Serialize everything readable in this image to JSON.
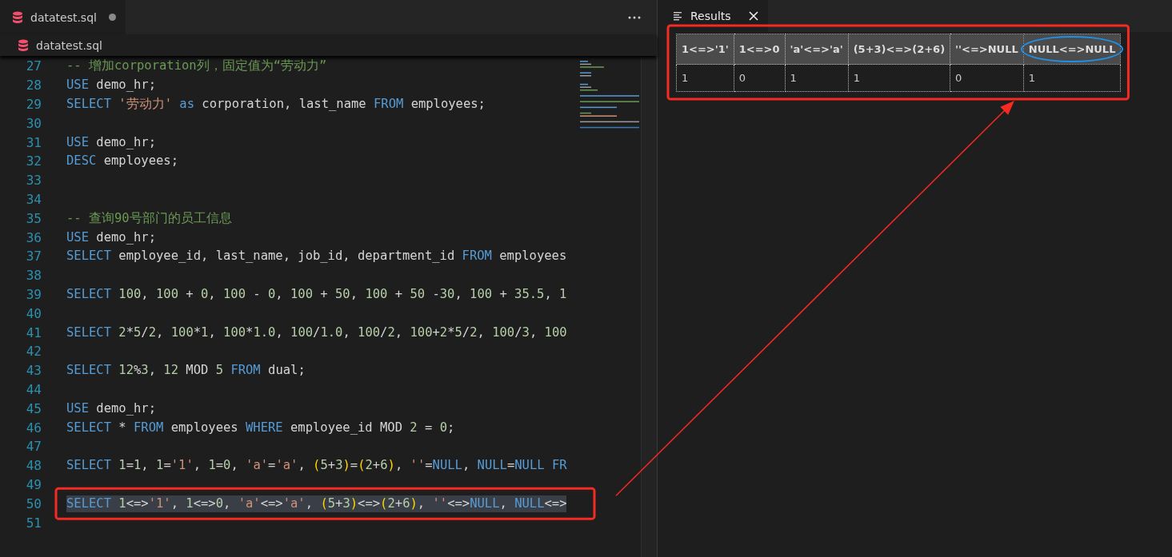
{
  "editor": {
    "tabs": [
      {
        "label": "datatest.sql",
        "modified": true,
        "selected": true
      }
    ],
    "breadcrumb": "datatest.sql",
    "lines": [
      {
        "number": "27",
        "selected": false,
        "boxed": false,
        "tokens": [
          {
            "kind": "comment",
            "text": "-- 增加corporation列，固定值为“劳动力”"
          }
        ]
      },
      {
        "number": "28",
        "selected": false,
        "boxed": false,
        "tokens": [
          {
            "kind": "keyword",
            "text": "USE"
          },
          {
            "kind": "plain",
            "text": " demo_hr;"
          }
        ]
      },
      {
        "number": "29",
        "selected": false,
        "boxed": false,
        "tokens": [
          {
            "kind": "keyword",
            "text": "SELECT"
          },
          {
            "kind": "string",
            "text": " '劳动力'"
          },
          {
            "kind": "keyword",
            "text": " as"
          },
          {
            "kind": "plain",
            "text": " corporation, last_name "
          },
          {
            "kind": "keyword",
            "text": "FROM"
          },
          {
            "kind": "plain",
            "text": " employees;"
          }
        ]
      },
      {
        "number": "30",
        "selected": false,
        "boxed": false
      },
      {
        "number": "31",
        "selected": false,
        "boxed": false,
        "tokens": [
          {
            "kind": "keyword",
            "text": "USE"
          },
          {
            "kind": "plain",
            "text": " demo_hr;"
          }
        ]
      },
      {
        "number": "32",
        "selected": false,
        "boxed": false,
        "tokens": [
          {
            "kind": "keyword",
            "text": "DESC"
          },
          {
            "kind": "plain",
            "text": " employees;"
          }
        ]
      },
      {
        "number": "33",
        "selected": false,
        "boxed": false
      },
      {
        "number": "34",
        "selected": false,
        "boxed": false
      },
      {
        "number": "35",
        "selected": false,
        "boxed": false,
        "tokens": [
          {
            "kind": "comment",
            "text": "-- 查询90号部门的员工信息"
          }
        ]
      },
      {
        "number": "36",
        "selected": false,
        "boxed": false,
        "tokens": [
          {
            "kind": "keyword",
            "text": "USE"
          },
          {
            "kind": "plain",
            "text": " demo_hr;"
          }
        ]
      },
      {
        "number": "37",
        "selected": false,
        "boxed": false,
        "tokens": [
          {
            "kind": "keyword",
            "text": "SELECT"
          },
          {
            "kind": "plain",
            "text": " employee_id, last_name, job_id, department_id "
          },
          {
            "kind": "keyword",
            "text": "FROM"
          },
          {
            "kind": "plain",
            "text": " employees"
          }
        ]
      },
      {
        "number": "38",
        "selected": false,
        "boxed": false
      },
      {
        "number": "39",
        "selected": false,
        "boxed": false,
        "tokens": [
          {
            "kind": "keyword",
            "text": "SELECT"
          },
          {
            "kind": "number",
            "text": " 100"
          },
          {
            "kind": "plain",
            "text": ", "
          },
          {
            "kind": "number",
            "text": "100"
          },
          {
            "kind": "plain",
            "text": " + "
          },
          {
            "kind": "number",
            "text": "0"
          },
          {
            "kind": "plain",
            "text": ", "
          },
          {
            "kind": "number",
            "text": "100"
          },
          {
            "kind": "plain",
            "text": " - "
          },
          {
            "kind": "number",
            "text": "0"
          },
          {
            "kind": "plain",
            "text": ", "
          },
          {
            "kind": "number",
            "text": "100"
          },
          {
            "kind": "plain",
            "text": " + "
          },
          {
            "kind": "number",
            "text": "50"
          },
          {
            "kind": "plain",
            "text": ", "
          },
          {
            "kind": "number",
            "text": "100"
          },
          {
            "kind": "plain",
            "text": " + "
          },
          {
            "kind": "number",
            "text": "50"
          },
          {
            "kind": "plain",
            "text": " -"
          },
          {
            "kind": "number",
            "text": "30"
          },
          {
            "kind": "plain",
            "text": ", "
          },
          {
            "kind": "number",
            "text": "100"
          },
          {
            "kind": "plain",
            "text": " + "
          },
          {
            "kind": "number",
            "text": "35.5"
          },
          {
            "kind": "plain",
            "text": ", "
          },
          {
            "kind": "number",
            "text": "1"
          }
        ]
      },
      {
        "number": "40",
        "selected": false,
        "boxed": false
      },
      {
        "number": "41",
        "selected": false,
        "boxed": false,
        "tokens": [
          {
            "kind": "keyword",
            "text": "SELECT"
          },
          {
            "kind": "number",
            "text": " 2"
          },
          {
            "kind": "plain",
            "text": "*"
          },
          {
            "kind": "number",
            "text": "5"
          },
          {
            "kind": "plain",
            "text": "/"
          },
          {
            "kind": "number",
            "text": "2"
          },
          {
            "kind": "plain",
            "text": ", "
          },
          {
            "kind": "number",
            "text": "100"
          },
          {
            "kind": "plain",
            "text": "*"
          },
          {
            "kind": "number",
            "text": "1"
          },
          {
            "kind": "plain",
            "text": ", "
          },
          {
            "kind": "number",
            "text": "100"
          },
          {
            "kind": "plain",
            "text": "*"
          },
          {
            "kind": "number",
            "text": "1.0"
          },
          {
            "kind": "plain",
            "text": ", "
          },
          {
            "kind": "number",
            "text": "100"
          },
          {
            "kind": "plain",
            "text": "/"
          },
          {
            "kind": "number",
            "text": "1.0"
          },
          {
            "kind": "plain",
            "text": ", "
          },
          {
            "kind": "number",
            "text": "100"
          },
          {
            "kind": "plain",
            "text": "/"
          },
          {
            "kind": "number",
            "text": "2"
          },
          {
            "kind": "plain",
            "text": ", "
          },
          {
            "kind": "number",
            "text": "100"
          },
          {
            "kind": "plain",
            "text": "+"
          },
          {
            "kind": "number",
            "text": "2"
          },
          {
            "kind": "plain",
            "text": "*"
          },
          {
            "kind": "number",
            "text": "5"
          },
          {
            "kind": "plain",
            "text": "/"
          },
          {
            "kind": "number",
            "text": "2"
          },
          {
            "kind": "plain",
            "text": ", "
          },
          {
            "kind": "number",
            "text": "100"
          },
          {
            "kind": "plain",
            "text": "/"
          },
          {
            "kind": "number",
            "text": "3"
          },
          {
            "kind": "plain",
            "text": ", "
          },
          {
            "kind": "number",
            "text": "100"
          }
        ]
      },
      {
        "number": "42",
        "selected": false,
        "boxed": false
      },
      {
        "number": "43",
        "selected": false,
        "boxed": false,
        "tokens": [
          {
            "kind": "keyword",
            "text": "SELECT"
          },
          {
            "kind": "number",
            "text": " 12"
          },
          {
            "kind": "plain",
            "text": "%"
          },
          {
            "kind": "number",
            "text": "3"
          },
          {
            "kind": "plain",
            "text": ", "
          },
          {
            "kind": "number",
            "text": "12"
          },
          {
            "kind": "plain",
            "text": " MOD "
          },
          {
            "kind": "number",
            "text": "5"
          },
          {
            "kind": "keyword",
            "text": " FROM"
          },
          {
            "kind": "plain",
            "text": " dual;"
          }
        ]
      },
      {
        "number": "44",
        "selected": false,
        "boxed": false
      },
      {
        "number": "45",
        "selected": false,
        "boxed": false,
        "tokens": [
          {
            "kind": "keyword",
            "text": "USE"
          },
          {
            "kind": "plain",
            "text": " demo_hr;"
          }
        ]
      },
      {
        "number": "46",
        "selected": false,
        "boxed": false,
        "tokens": [
          {
            "kind": "keyword",
            "text": "SELECT"
          },
          {
            "kind": "plain",
            "text": " * "
          },
          {
            "kind": "keyword",
            "text": "FROM"
          },
          {
            "kind": "plain",
            "text": " employees "
          },
          {
            "kind": "keyword",
            "text": "WHERE"
          },
          {
            "kind": "plain",
            "text": " employee_id MOD "
          },
          {
            "kind": "number",
            "text": "2"
          },
          {
            "kind": "plain",
            "text": " = "
          },
          {
            "kind": "number",
            "text": "0"
          },
          {
            "kind": "plain",
            "text": ";"
          }
        ]
      },
      {
        "number": "47",
        "selected": false,
        "boxed": false
      },
      {
        "number": "48",
        "selected": false,
        "boxed": false,
        "tokens": [
          {
            "kind": "keyword",
            "text": "SELECT"
          },
          {
            "kind": "number",
            "text": " 1"
          },
          {
            "kind": "plain",
            "text": "="
          },
          {
            "kind": "number",
            "text": "1"
          },
          {
            "kind": "plain",
            "text": ", "
          },
          {
            "kind": "number",
            "text": "1"
          },
          {
            "kind": "plain",
            "text": "="
          },
          {
            "kind": "string",
            "text": "'1'"
          },
          {
            "kind": "plain",
            "text": ", "
          },
          {
            "kind": "number",
            "text": "1"
          },
          {
            "kind": "plain",
            "text": "="
          },
          {
            "kind": "number",
            "text": "0"
          },
          {
            "kind": "plain",
            "text": ", "
          },
          {
            "kind": "string",
            "text": "'a'"
          },
          {
            "kind": "plain",
            "text": "="
          },
          {
            "kind": "string",
            "text": "'a'"
          },
          {
            "kind": "plain",
            "text": ", "
          },
          {
            "kind": "paren",
            "text": "("
          },
          {
            "kind": "number",
            "text": "5"
          },
          {
            "kind": "plain",
            "text": "+"
          },
          {
            "kind": "number",
            "text": "3"
          },
          {
            "kind": "paren",
            "text": ")"
          },
          {
            "kind": "plain",
            "text": "="
          },
          {
            "kind": "paren",
            "text": "("
          },
          {
            "kind": "number",
            "text": "2"
          },
          {
            "kind": "plain",
            "text": "+"
          },
          {
            "kind": "number",
            "text": "6"
          },
          {
            "kind": "paren",
            "text": ")"
          },
          {
            "kind": "plain",
            "text": ", "
          },
          {
            "kind": "string",
            "text": "''"
          },
          {
            "kind": "plain",
            "text": "="
          },
          {
            "kind": "keyword",
            "text": "NULL"
          },
          {
            "kind": "plain",
            "text": ", "
          },
          {
            "kind": "keyword",
            "text": "NULL"
          },
          {
            "kind": "plain",
            "text": "="
          },
          {
            "kind": "keyword",
            "text": "NULL"
          },
          {
            "kind": "keyword",
            "text": " FR"
          }
        ]
      },
      {
        "number": "49",
        "selected": false,
        "boxed": false
      },
      {
        "number": "50",
        "selected": true,
        "boxed": true,
        "tokens": [
          {
            "kind": "keyword",
            "text": "SELECT"
          },
          {
            "kind": "number",
            "text": " 1"
          },
          {
            "kind": "plain",
            "text": "<=>"
          },
          {
            "kind": "string",
            "text": "'1'"
          },
          {
            "kind": "plain",
            "text": ", "
          },
          {
            "kind": "number",
            "text": "1"
          },
          {
            "kind": "plain",
            "text": "<=>"
          },
          {
            "kind": "number",
            "text": "0"
          },
          {
            "kind": "plain",
            "text": ", "
          },
          {
            "kind": "string",
            "text": "'a'"
          },
          {
            "kind": "plain",
            "text": "<=>"
          },
          {
            "kind": "string",
            "text": "'a'"
          },
          {
            "kind": "plain",
            "text": ", "
          },
          {
            "kind": "paren",
            "text": "("
          },
          {
            "kind": "number",
            "text": "5"
          },
          {
            "kind": "plain",
            "text": "+"
          },
          {
            "kind": "number",
            "text": "3"
          },
          {
            "kind": "paren",
            "text": ")"
          },
          {
            "kind": "plain",
            "text": "<=>"
          },
          {
            "kind": "paren",
            "text": "("
          },
          {
            "kind": "number",
            "text": "2"
          },
          {
            "kind": "plain",
            "text": "+"
          },
          {
            "kind": "number",
            "text": "6"
          },
          {
            "kind": "paren",
            "text": ")"
          },
          {
            "kind": "plain",
            "text": ", "
          },
          {
            "kind": "string",
            "text": "''"
          },
          {
            "kind": "plain",
            "text": "<=>"
          },
          {
            "kind": "keyword",
            "text": "NULL"
          },
          {
            "kind": "plain",
            "text": ", "
          },
          {
            "kind": "keyword",
            "text": "NULL"
          },
          {
            "kind": "plain",
            "text": "<=>"
          }
        ]
      },
      {
        "number": "51",
        "selected": false,
        "boxed": false
      }
    ]
  },
  "results": {
    "tab": {
      "label": "Results"
    },
    "boxed": true,
    "columns": [
      {
        "label": "1<=>'1'",
        "circled": false
      },
      {
        "label": "1<=>0",
        "circled": false
      },
      {
        "label": "'a'<=>'a'",
        "circled": false
      },
      {
        "label": "(5+3)<=>(2+6)",
        "circled": false
      },
      {
        "label": "''<=>NULL",
        "circled": false
      },
      {
        "label": "NULL<=>NULL",
        "circled": true
      }
    ],
    "rows": [
      [
        "1",
        "0",
        "1",
        "1",
        "0",
        "1"
      ]
    ]
  },
  "annotation_arrow": true
}
